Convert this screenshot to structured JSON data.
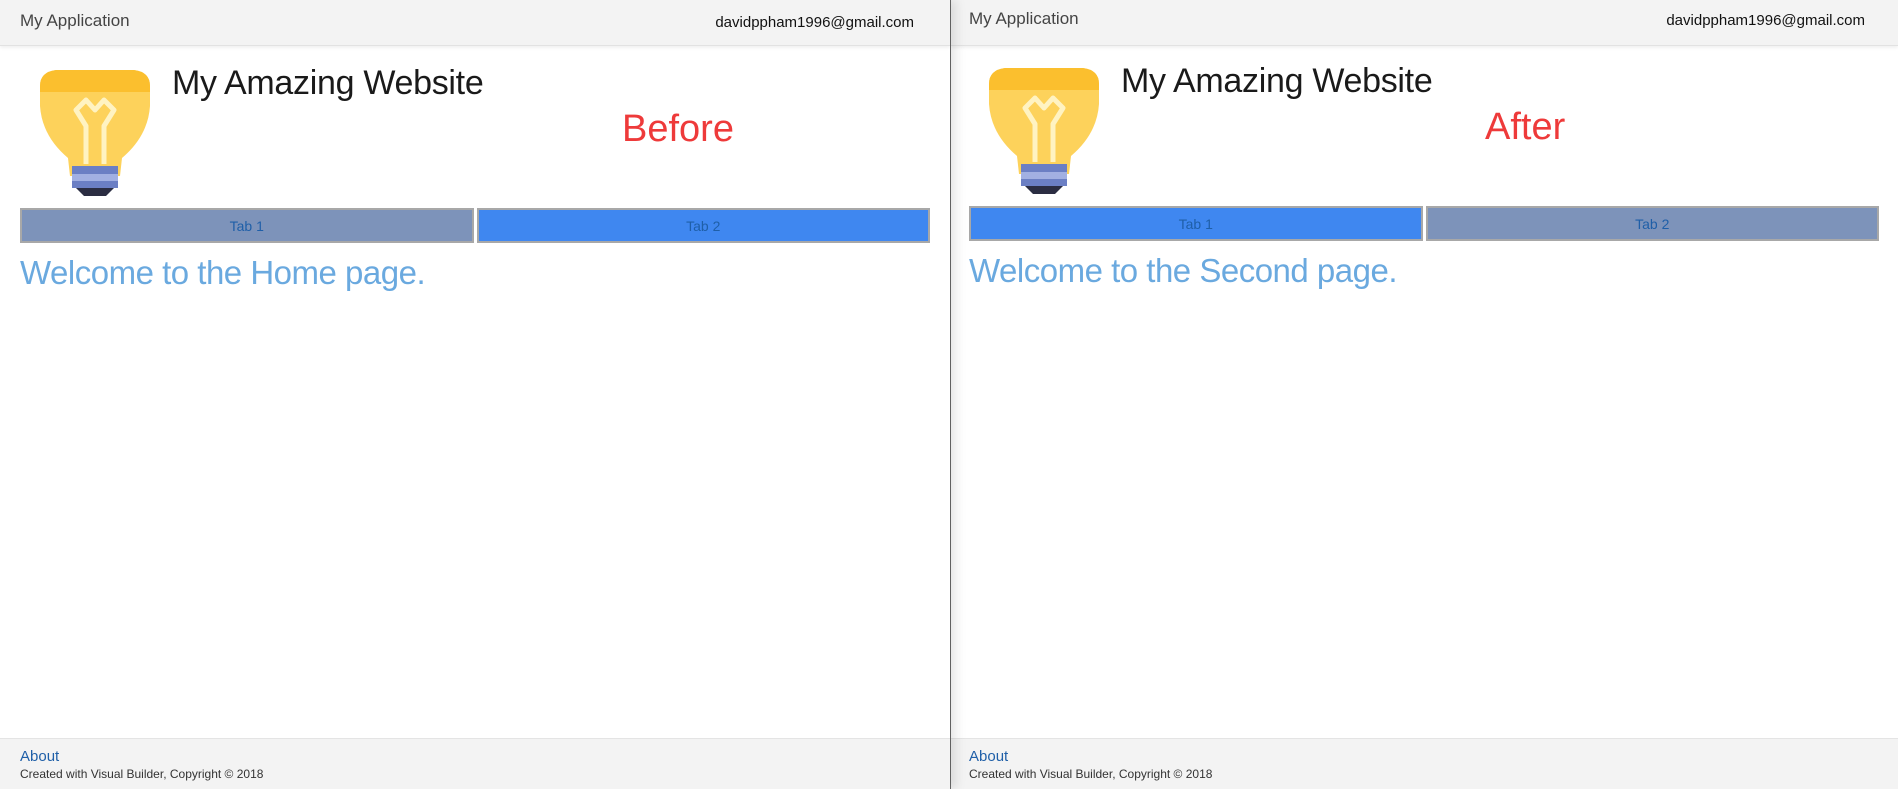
{
  "panels": [
    {
      "brand": "My Application",
      "email": "davidppham1996@gmail.com",
      "site_title": "My Amazing Website",
      "state_label": "Before",
      "tabs": [
        {
          "label": "Tab 1",
          "state": "inactive"
        },
        {
          "label": "Tab 2",
          "state": "active"
        }
      ],
      "welcome": "Welcome to the Home page.",
      "footer": {
        "about": "About",
        "copyright": "Created with Visual Builder, Copyright © 2018"
      }
    },
    {
      "brand": "My Application",
      "email": "davidppham1996@gmail.com",
      "site_title": "My Amazing Website",
      "state_label": "After",
      "tabs": [
        {
          "label": "Tab 1",
          "state": "active"
        },
        {
          "label": "Tab 2",
          "state": "inactive"
        }
      ],
      "welcome": "Welcome to the Second page.",
      "footer": {
        "about": "About",
        "copyright": "Created with Visual Builder, Copyright © 2018"
      }
    }
  ],
  "icons": {
    "logo": "lightbulb-icon"
  },
  "colors": {
    "tab_active": "#3f87f0",
    "tab_inactive": "#7d93ba",
    "tab_text": "#1f5fa8",
    "welcome_text": "#6aa9df",
    "state_label": "#ee3a3a",
    "bulb_yellow": "#fdd25b",
    "bulb_top": "#fbbf2e",
    "bulb_base": "#6b7fc4"
  }
}
